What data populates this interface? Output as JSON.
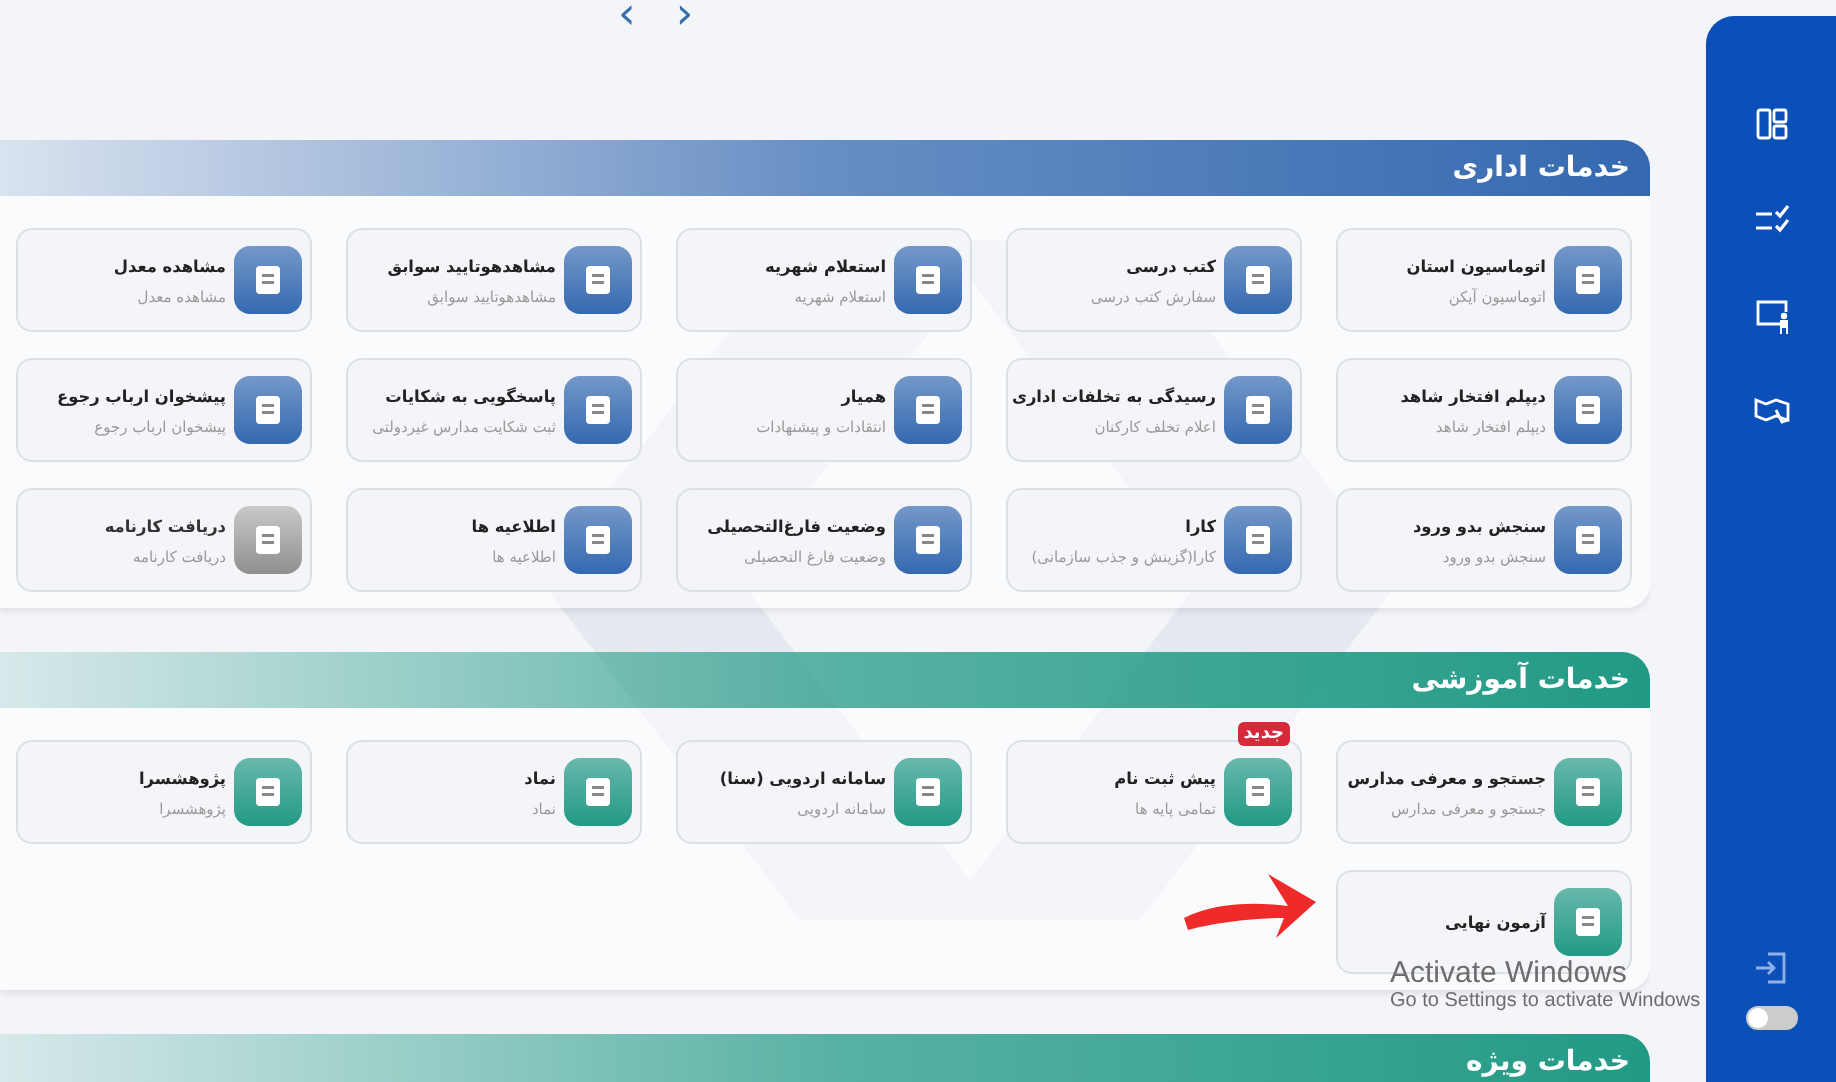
{
  "pager": {
    "prev": "‹",
    "next": "›"
  },
  "sections": [
    {
      "title": "خدمات اداری",
      "color": "#3469b0",
      "cards": [
        {
          "title": "اتوماسیون استان",
          "subtitle": "اتوماسیون آیکن",
          "disabled": false
        },
        {
          "title": "کتب درسی",
          "subtitle": "سفارش کتب درسی",
          "disabled": false
        },
        {
          "title": "استعلام شهریه",
          "subtitle": "استعلام شهریه",
          "disabled": false
        },
        {
          "title": "مشاهدهوتایید سوابق",
          "subtitle": "مشاهدهوتایید سوابق",
          "disabled": false
        },
        {
          "title": "مشاهده معدل",
          "subtitle": "مشاهده معدل",
          "disabled": false
        },
        {
          "title": "دیپلم افتخار شاهد",
          "subtitle": "دیپلم افتخار شاهد",
          "disabled": false
        },
        {
          "title": "رسیدگی به تخلفات اداری",
          "subtitle": "اعلام تخلف کارکنان",
          "disabled": false
        },
        {
          "title": "همیار",
          "subtitle": "انتقادات و پیشنهادات",
          "disabled": false
        },
        {
          "title": "پاسخگویی به شکایات",
          "subtitle": "ثبت شکایت مدارس غیردولتی",
          "disabled": false
        },
        {
          "title": "پیشخوان ارباب رجوع",
          "subtitle": "پیشخوان ارباب رجوع",
          "disabled": false
        },
        {
          "title": "سنجش بدو ورود",
          "subtitle": "سنجش بدو ورود",
          "disabled": false
        },
        {
          "title": "کارا",
          "subtitle": "کارا(گزینش و جذب سازمانی)",
          "disabled": false
        },
        {
          "title": "وضعیت فارغ‌التحصیلی",
          "subtitle": "وضعیت فارغ التحصیلی",
          "disabled": false
        },
        {
          "title": "اطلاعیه ها",
          "subtitle": "اطلاعیه ها",
          "disabled": false
        },
        {
          "title": "دریافت کارنامه",
          "subtitle": "دریافت کارنامه",
          "disabled": true
        }
      ]
    },
    {
      "title": "خدمات آموزشی",
      "color": "#219a85",
      "cards": [
        {
          "title": "جستجو و معرفی مدارس",
          "subtitle": "جستجو و معرفی مدارس",
          "disabled": false
        },
        {
          "title": "پیش ثبت نام",
          "subtitle": "تمامی پایه ها",
          "badge": "جدید",
          "disabled": false
        },
        {
          "title": "سامانه اردویی (سنا)",
          "subtitle": "سامانه اردویی",
          "disabled": false
        },
        {
          "title": "نماد",
          "subtitle": "نماد",
          "disabled": false
        },
        {
          "title": "پژوهشسرا",
          "subtitle": "پژوهشسرا",
          "disabled": false
        },
        {
          "title": "آزمون نهایی",
          "disabled": false,
          "pointed": true
        }
      ]
    },
    {
      "title": "خدمات ویژه",
      "color": "#219a85"
    }
  ],
  "sidebar": {
    "toggle": {
      "on": false
    }
  },
  "os_overlay": {
    "title": "Activate Windows",
    "text": "Go to Settings to activate Windows"
  }
}
